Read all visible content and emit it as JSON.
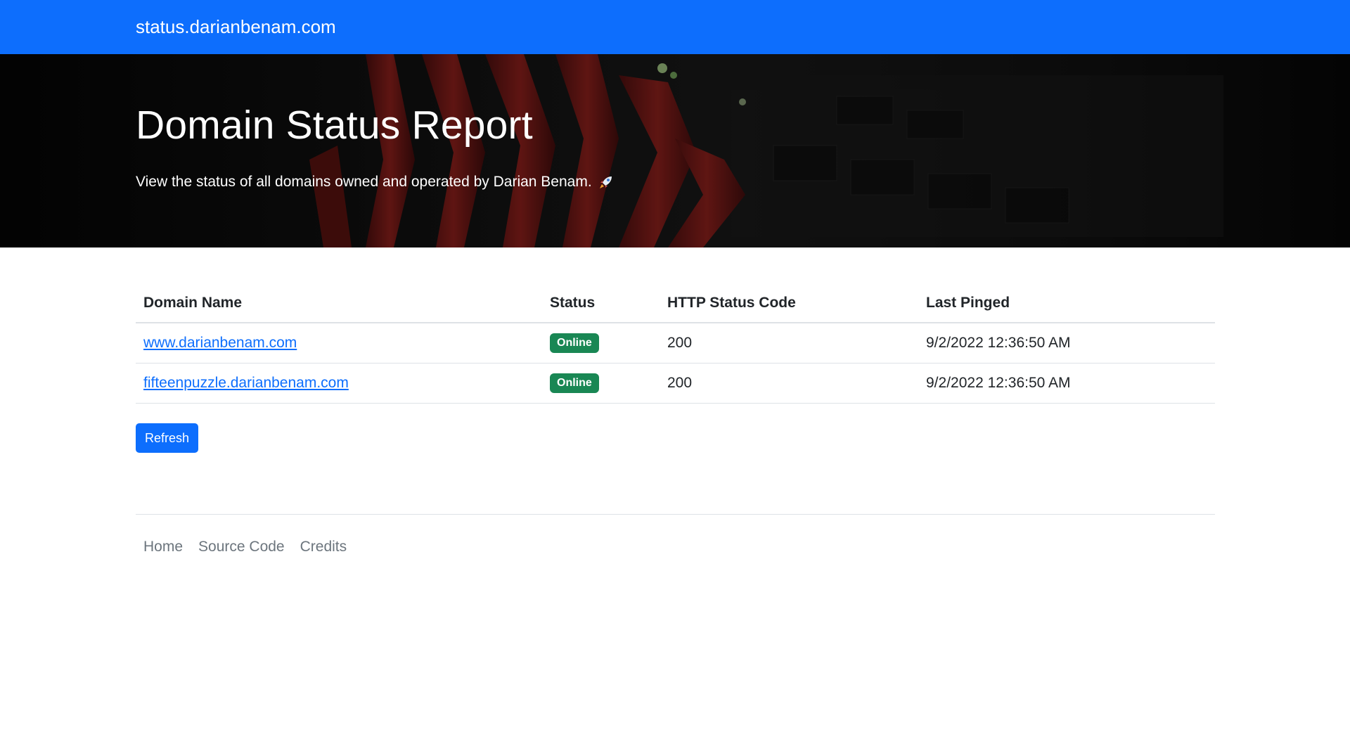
{
  "navbar": {
    "brand": "status.darianbenam.com"
  },
  "hero": {
    "title": "Domain Status Report",
    "subtitle": "View the status of all domains owned and operated by Darian Benam.",
    "icon": "rocket-icon"
  },
  "table": {
    "headers": {
      "domain": "Domain Name",
      "status": "Status",
      "code": "HTTP Status Code",
      "pinged": "Last Pinged"
    },
    "rows": [
      {
        "domain": "www.darianbenam.com",
        "status": "Online",
        "code": "200",
        "pinged": "9/2/2022 12:36:50 AM"
      },
      {
        "domain": "fifteenpuzzle.darianbenam.com",
        "status": "Online",
        "code": "200",
        "pinged": "9/2/2022 12:36:50 AM"
      }
    ]
  },
  "actions": {
    "refresh_label": "Refresh"
  },
  "footer": {
    "links": [
      "Home",
      "Source Code",
      "Credits"
    ]
  },
  "colors": {
    "primary": "#0d6efd",
    "success": "#198754",
    "muted": "#6c757d"
  }
}
